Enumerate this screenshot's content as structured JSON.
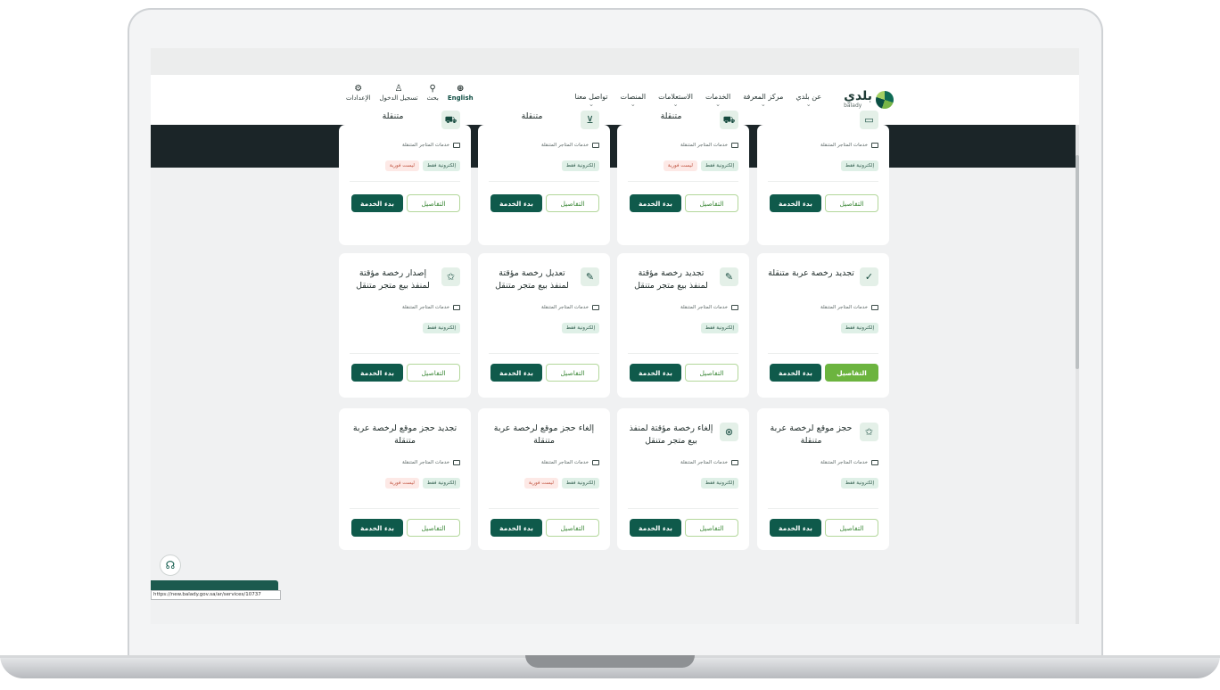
{
  "header": {
    "logo_ar": "بلدي",
    "logo_en": "balady",
    "nav": [
      {
        "label": "عن بلدي"
      },
      {
        "label": "مركز المعرفة"
      },
      {
        "label": "الخدمات"
      },
      {
        "label": "الاستعلامات"
      },
      {
        "label": "المنصات"
      },
      {
        "label": "تواصل معنا"
      }
    ],
    "tools": {
      "english": "English",
      "search": "بحث",
      "login": "تسجيل الدخول",
      "settings": "الإعدادات"
    }
  },
  "labels": {
    "category": "خدمات المتاجر المتنقلة",
    "electronic_only": "إلكترونية فقط",
    "not_instant": "ليست فورية",
    "details": "التفاصيل",
    "start": "بدء الخدمة"
  },
  "cards": [
    {
      "title": "",
      "icon": "doc-icon",
      "instant": true
    },
    {
      "title": "متنقلة",
      "icon": "truck-icon",
      "instant": false
    },
    {
      "title": "متنقلة",
      "icon": "cart-icon",
      "instant": true
    },
    {
      "title": "متنقلة",
      "icon": "truck-icon",
      "instant": false
    },
    {
      "title": "تجديد رخصة عربة متنقلة",
      "icon": "cart-check-icon",
      "instant": true
    },
    {
      "title": "تجديد رخصة مؤقتة لمنفذ بيع متجر متنقل",
      "icon": "edit-store-icon",
      "instant": true
    },
    {
      "title": "تعديل رخصة مؤقتة لمنفذ بيع متجر متنقل",
      "icon": "edit-store-icon",
      "instant": true
    },
    {
      "title": "إصدار رخصة مؤقتة لمنفذ بيع متجر متنقل",
      "icon": "store-star-icon",
      "instant": true
    },
    {
      "title": "حجز موقع لرخصة عربة متنقلة",
      "icon": "store-star-icon",
      "instant": true
    },
    {
      "title": "إلغاء رخصة مؤقتة لمنفذ بيع متجر متنقل",
      "icon": "store-cancel-icon",
      "instant": true
    },
    {
      "title": "إلغاء حجز موقع لرخصة عربة متنقلة",
      "icon": "",
      "instant": false
    },
    {
      "title": "تجديد حجز موقع لرخصة عربة متنقلة",
      "icon": "",
      "instant": false
    }
  ],
  "status_url": "https://new.balady.gov.sa/ar/services/10737"
}
